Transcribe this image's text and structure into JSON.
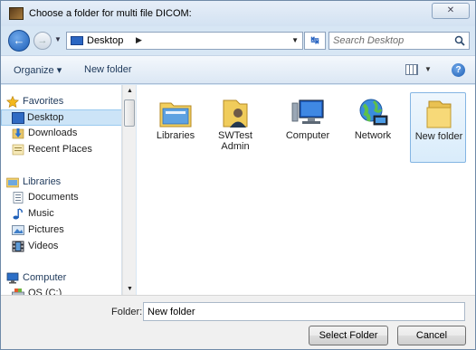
{
  "window": {
    "title": "Choose a folder for multi file DICOM:",
    "close_glyph": "✕"
  },
  "address": {
    "location": "Desktop",
    "breadcrumb_arrow": "▶",
    "search_placeholder": "Search Desktop"
  },
  "toolbar": {
    "organize_label": "Organize ▾",
    "new_folder_label": "New folder",
    "help_glyph": "?"
  },
  "nav": {
    "items": [
      {
        "label": "Favorites",
        "icon": "star-icon"
      },
      {
        "label": "Desktop",
        "icon": "desktop-icon"
      },
      {
        "label": "Downloads",
        "icon": "downloads-icon"
      },
      {
        "label": "Recent Places",
        "icon": "recent-places-icon"
      },
      {
        "label": "Libraries",
        "icon": "libraries-icon"
      },
      {
        "label": "Documents",
        "icon": "documents-icon"
      },
      {
        "label": "Music",
        "icon": "music-icon"
      },
      {
        "label": "Pictures",
        "icon": "pictures-icon"
      },
      {
        "label": "Videos",
        "icon": "videos-icon"
      },
      {
        "label": "Computer",
        "icon": "computer-icon"
      },
      {
        "label": "OS (C:)",
        "icon": "drive-icon"
      }
    ]
  },
  "files": [
    {
      "label": "Libraries",
      "icon": "libraries-folder-icon"
    },
    {
      "label": "SWTest Admin",
      "icon": "user-folder-icon"
    },
    {
      "label": "Computer",
      "icon": "computer-icon"
    },
    {
      "label": "Network",
      "icon": "network-icon"
    },
    {
      "label": "New folder",
      "icon": "folder-icon"
    }
  ],
  "footer": {
    "folder_label": "Folder:",
    "folder_value": "New folder",
    "select_button": "Select Folder",
    "cancel_button": "Cancel"
  },
  "colors": {
    "selection": "#cce4f7",
    "toolbar_text": "#1e395b",
    "chrome": "#d7e6f4"
  }
}
